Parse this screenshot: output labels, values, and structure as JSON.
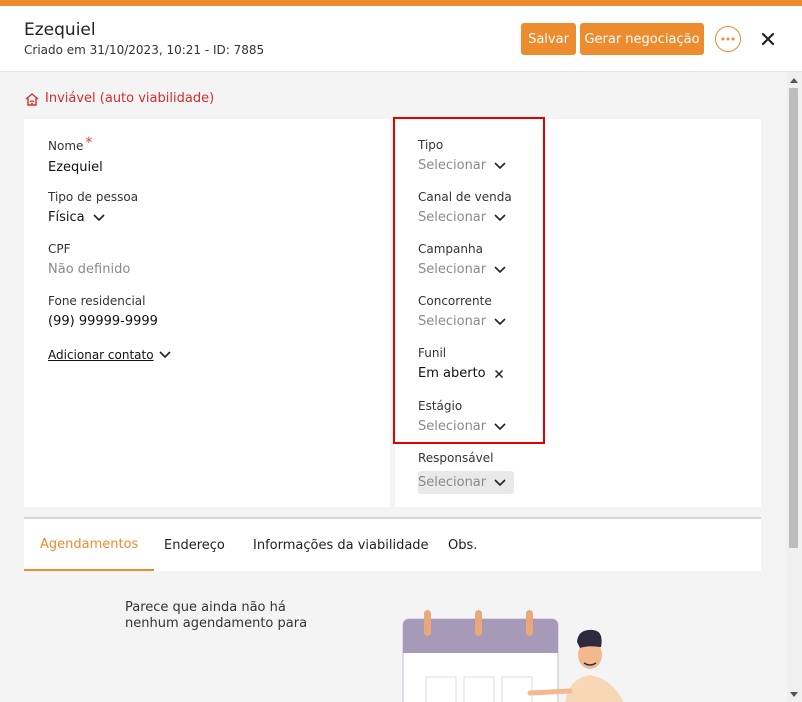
{
  "header": {
    "title": "Ezequiel",
    "subtitle": "Criado em 31/10/2023, 10:21 - ID: 7885",
    "save_label": "Salvar",
    "deal_label": "Gerar negociação"
  },
  "status": {
    "text": "Inviável (auto viabilidade)",
    "icon": "house-wifi-icon",
    "color": "#d32f2f"
  },
  "left": {
    "name_label": "Nome",
    "name_required": "*",
    "name_value": "Ezequiel",
    "person_type_label": "Tipo de pessoa",
    "person_type_value": "Física",
    "cpf_label": "CPF",
    "cpf_value": "Não definido",
    "phone_label": "Fone residencial",
    "phone_value": "(99) 99999-9999",
    "add_contact_label": "Adicionar contato"
  },
  "right": {
    "tipo_label": "Tipo",
    "tipo_value": "Selecionar",
    "canal_label": "Canal de venda",
    "canal_value": "Selecionar",
    "campanha_label": "Campanha",
    "campanha_value": "Selecionar",
    "concorrente_label": "Concorrente",
    "concorrente_value": "Selecionar",
    "funil_label": "Funil",
    "funil_value": "Em aberto",
    "estagio_label": "Estágio",
    "estagio_value": "Selecionar",
    "responsavel_label": "Responsável",
    "responsavel_value": "Selecionar"
  },
  "tabs": [
    {
      "label": "Agendamentos",
      "active": true
    },
    {
      "label": "Endereço"
    },
    {
      "label": "Informações da viabilidade"
    },
    {
      "label": "Obs."
    }
  ],
  "empty_state": {
    "text": "Parece que ainda não há nenhum agendamento para"
  },
  "colors": {
    "accent": "#ed8b2f",
    "error": "#d32f2f",
    "highlight": "#e30000"
  }
}
